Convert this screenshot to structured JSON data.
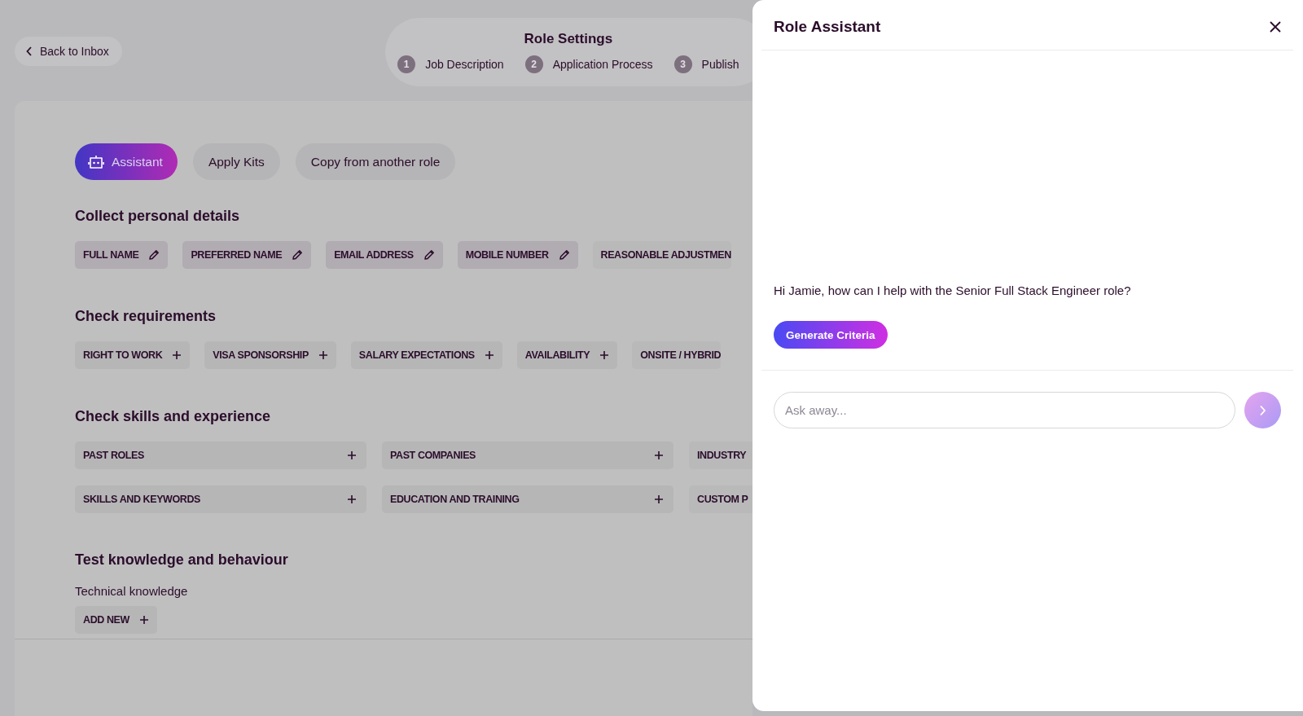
{
  "back_button": {
    "label": "Back to Inbox"
  },
  "stepper": {
    "title": "Role Settings",
    "steps": [
      {
        "number": "1",
        "label": "Job Description"
      },
      {
        "number": "2",
        "label": "Application Process"
      },
      {
        "number": "3",
        "label": "Publish"
      }
    ]
  },
  "toolbar": [
    {
      "label": "Assistant",
      "kind": "primary"
    },
    {
      "label": "Apply Kits",
      "kind": "secondary"
    },
    {
      "label": "Copy from another role",
      "kind": "secondary"
    }
  ],
  "sections": [
    {
      "title": "Collect personal details",
      "kind": "chips",
      "items": [
        {
          "label": "FULL NAME",
          "kind": "editable"
        },
        {
          "label": "PREFERRED NAME",
          "kind": "editable"
        },
        {
          "label": "EMAIL ADDRESS",
          "kind": "editable"
        },
        {
          "label": "MOBILE NUMBER",
          "kind": "editable"
        },
        {
          "label": "REASONABLE ADJUSTMEN",
          "kind": "plain"
        }
      ]
    },
    {
      "title": "Check requirements",
      "kind": "chips",
      "items": [
        {
          "label": "RIGHT TO WORK",
          "kind": "addable"
        },
        {
          "label": "VISA SPONSORSHIP",
          "kind": "addable"
        },
        {
          "label": "SALARY EXPECTATIONS",
          "kind": "addable"
        },
        {
          "label": "AVAILABILITY",
          "kind": "addable"
        },
        {
          "label": "ONSITE / HYBRID",
          "kind": "plain"
        }
      ]
    },
    {
      "title": "Check skills and experience",
      "kind": "grid",
      "items": [
        {
          "label": "PAST ROLES",
          "kind": "addable"
        },
        {
          "label": "PAST COMPANIES",
          "kind": "addable"
        },
        {
          "label": "INDUSTRY",
          "kind": "plain"
        },
        {
          "label": "SKILLS AND KEYWORDS",
          "kind": "addable"
        },
        {
          "label": "EDUCATION AND TRAINING",
          "kind": "addable"
        },
        {
          "label": "CUSTOM P",
          "kind": "plain"
        }
      ]
    },
    {
      "title": "Test knowledge and behaviour",
      "kind": "groups",
      "groups": [
        {
          "title": "Technical knowledge",
          "items": [
            {
              "label": "ADD NEW",
              "kind": "addable"
            }
          ]
        }
      ]
    }
  ],
  "assistant_panel": {
    "title": "Role Assistant",
    "messages": [
      {
        "text": "Hi Jamie, how can I help with the Senior Full Stack Engineer role?"
      }
    ],
    "suggestions": [
      {
        "label": "Generate Criteria"
      }
    ],
    "input": {
      "placeholder": "Ask away..."
    }
  }
}
